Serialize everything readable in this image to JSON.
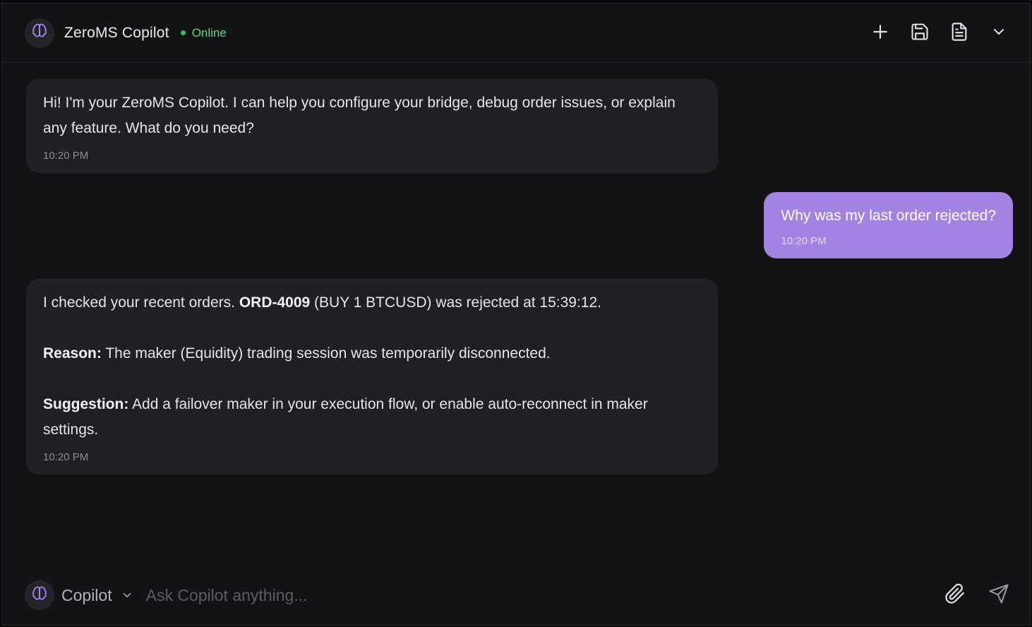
{
  "header": {
    "title": "ZeroMS Copilot",
    "status": "Online",
    "actions": [
      "plus-icon",
      "save-icon",
      "file-text-icon",
      "chevron-down-icon"
    ]
  },
  "messages": [
    {
      "role": "assistant",
      "paragraphs": [
        [
          "Hi! I'm your ZeroMS Copilot. I can help you configure your bridge, debug order issues, or explain any feature. What do you need?"
        ]
      ],
      "time": "10:20 PM"
    },
    {
      "role": "user",
      "text": "Why was my last order rejected?",
      "time": "10:20 PM"
    },
    {
      "role": "assistant",
      "p1": {
        "pre": "I checked your recent orders. ",
        "bold": "ORD-4009",
        "post": " (BUY 1 BTCUSD) was rejected at 15:39:12."
      },
      "p2": {
        "bold": "Reason:",
        "post": " The maker (Equidity) trading session was temporarily disconnected."
      },
      "p3": {
        "bold": "Suggestion:",
        "post": " Add a failover maker in your execution flow, or enable auto-reconnect in maker settings."
      },
      "time": "10:20 PM"
    }
  ],
  "composer": {
    "mode": "Copilot",
    "placeholder": "Ask Copilot anything...",
    "value": ""
  },
  "colors": {
    "accent": "#a283e2",
    "online": "#4ade80",
    "background": "#131316",
    "bubble": "#202024"
  }
}
